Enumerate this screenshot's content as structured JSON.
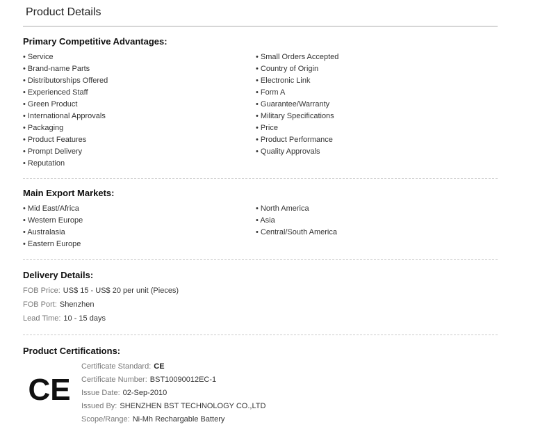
{
  "header": {
    "title": "Product Details"
  },
  "advantages": {
    "title": "Primary Competitive Advantages:",
    "left": [
      "Service",
      "Brand-name Parts",
      "Distributorships Offered",
      "Experienced Staff",
      "Green Product",
      "International Approvals",
      "Packaging",
      "Product Features",
      "Prompt Delivery",
      "Reputation"
    ],
    "right": [
      "Small Orders Accepted",
      "Country of Origin",
      "Electronic Link",
      "Form A",
      "Guarantee/Warranty",
      "Military Specifications",
      "Price",
      "Product Performance",
      "Quality Approvals"
    ]
  },
  "markets": {
    "title": "Main Export Markets:",
    "left": [
      "Mid East/Africa",
      "Western Europe",
      "Australasia",
      "Eastern Europe"
    ],
    "right": [
      "North America",
      "Asia",
      "Central/South America"
    ]
  },
  "delivery": {
    "title": "Delivery Details:",
    "fob_price_label": "FOB Price:",
    "fob_price_value": "US$ 15 - US$ 20 per unit (Pieces)",
    "fob_port_label": "FOB Port:",
    "fob_port_value": "Shenzhen",
    "lead_time_label": "Lead Time:",
    "lead_time_value": "10 - 15 days"
  },
  "certifications": {
    "title": "Product Certifications:",
    "logo_icon": "ce-mark-icon",
    "logo_text": "CE",
    "standard_label": "Certificate Standard:",
    "standard_value": "CE",
    "number_label": "Certificate Number:",
    "number_value": "BST10090012EC-1",
    "issue_date_label": "Issue Date:",
    "issue_date_value": "02-Sep-2010",
    "issued_by_label": "Issued By:",
    "issued_by_value": "SHENZHEN BST TECHNOLOGY CO.,LTD",
    "scope_label": "Scope/Range:",
    "scope_value": "Ni-Mh Rechargable Battery"
  }
}
